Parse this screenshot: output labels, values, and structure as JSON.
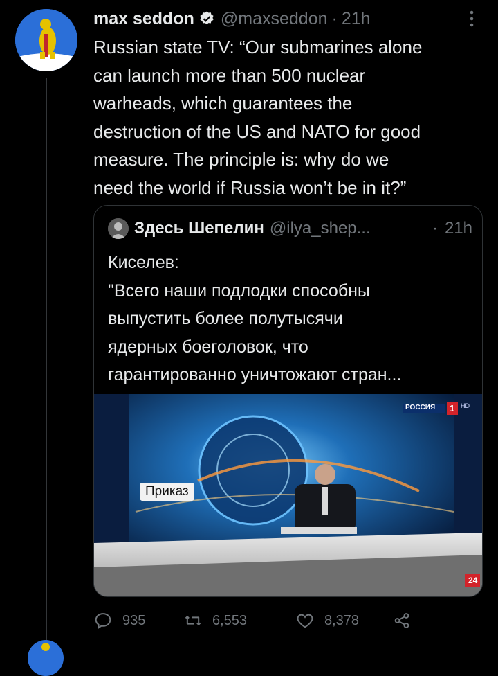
{
  "tweet": {
    "display_name": "max seddon",
    "handle": "@maxseddon",
    "separator": "·",
    "time": "21h",
    "text": "Russian state TV: “Our submarines alone\ncan launch more than 500 nuclear\nwarheads, which guarantees the\ndestruction of the US and NATO for good\nmeasure. The principle is: why do we\nneed the world if Russia won’t be in it?”",
    "icons": {
      "verified": "verified-badge-icon",
      "more": "more-options-icon"
    }
  },
  "quote": {
    "display_name": "Здесь Шепелин",
    "handle": "@ilya_shep...",
    "separator": "·",
    "time": "21h",
    "text": "Киселев:\n\"Всего наши подлодки способны\nвыпустить более полутысячи\nядерных боеголовок, что\nгарантированно уничтожают стран...",
    "media": {
      "caption_badge": "Приказ",
      "channel_logo": "РОССИЯ",
      "channel_number": "1",
      "channel_suffix": "HD",
      "corner_badge": "24"
    }
  },
  "actions": {
    "reply_count": "935",
    "retweet_count": "6,553",
    "like_count": "8,378",
    "icons": [
      "reply-icon",
      "retweet-icon",
      "like-icon",
      "share-icon"
    ]
  },
  "colors": {
    "background": "#000000",
    "text_primary": "#e7e9ea",
    "text_secondary": "#71767b",
    "verified": "#1d9bf0",
    "border": "#2f3336"
  }
}
